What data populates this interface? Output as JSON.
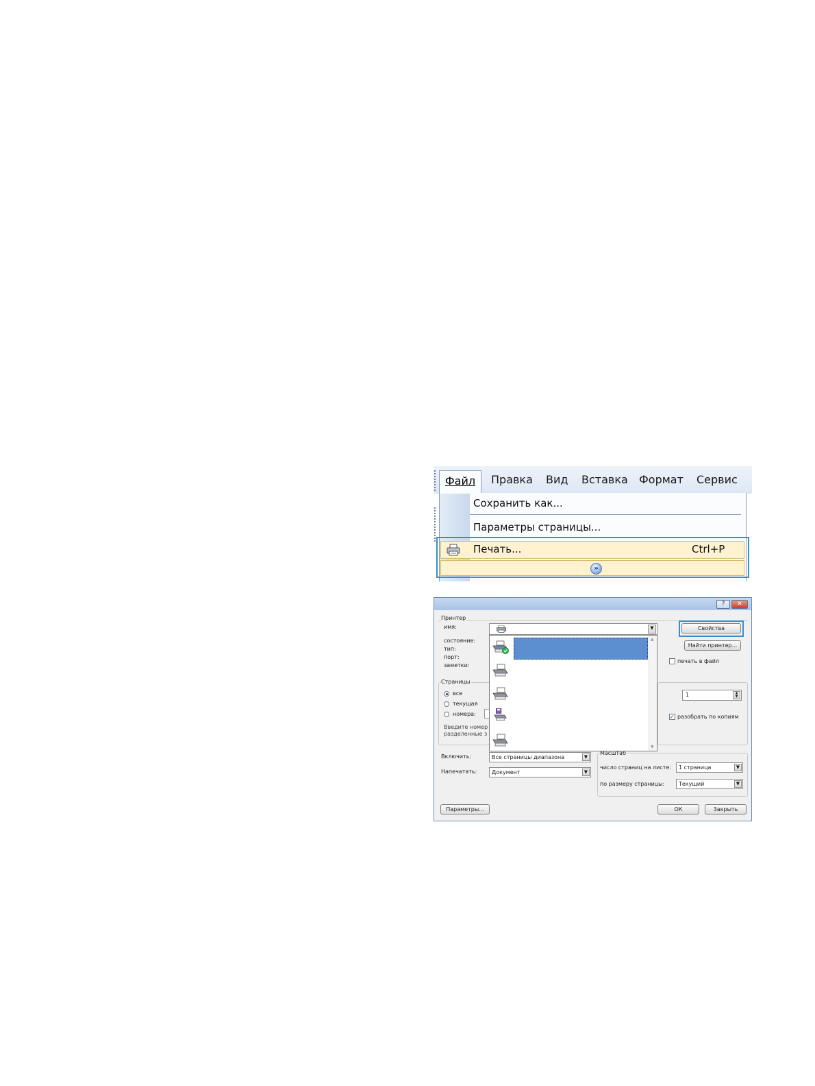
{
  "menu": {
    "bar": [
      "Файл",
      "Правка",
      "Вид",
      "Вставка",
      "Формат",
      "Сервис"
    ],
    "items": {
      "save_as": "Сохранить как...",
      "page_setup": "Параметры страницы...",
      "print": "Печать...",
      "print_shortcut": "Ctrl+P"
    },
    "icons": {
      "print": "printer-icon",
      "expand": "double-chevron-down-icon"
    },
    "highlight_color": "#3b8dc9"
  },
  "dialog": {
    "title_buttons": [
      "?",
      "✕"
    ],
    "printer": {
      "group_label": "Принтер",
      "name_label": "имя:",
      "status_label": "состояние:",
      "type_label": "тип:",
      "port_label": "порт:",
      "notes_label": "заметки:",
      "properties_button": "Свойства",
      "find_button": "Найти принтер...",
      "print_to_file": "печать в файл",
      "print_to_file_checked": false
    },
    "pages": {
      "group_label": "Страницы",
      "all": "все",
      "current": "текущая",
      "numbers": "номера:",
      "hint_line1": "Введите номер",
      "hint_line2": "разделенные з",
      "selected": "all"
    },
    "copies": {
      "value": "1",
      "collate_label": "разобрать по копиям",
      "collate_checked": true
    },
    "include": {
      "label": "Включить:",
      "value": "Все страницы диапазона"
    },
    "print_what": {
      "label": "Напечатать:",
      "value": "Документ"
    },
    "scale": {
      "group_label": "Масштаб",
      "pages_per_sheet_label": "число страниц на листе:",
      "pages_per_sheet_value": "1 страница",
      "fit_label": "по размеру страницы:",
      "fit_value": "Текущий"
    },
    "buttons": {
      "options": "Параметры...",
      "ok": "ОК",
      "close": "Закрыть"
    },
    "printer_list": [
      {
        "icon": "default-printer-icon"
      },
      {
        "icon": "printer-icon"
      },
      {
        "icon": "printer-icon"
      },
      {
        "icon": "fax-printer-icon"
      },
      {
        "icon": "printer-icon"
      }
    ]
  }
}
